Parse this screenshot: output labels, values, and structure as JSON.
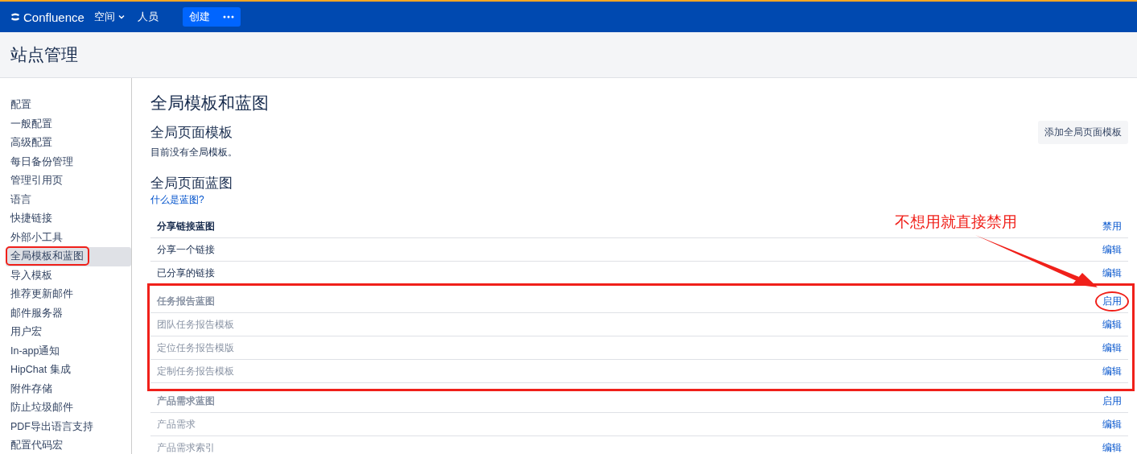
{
  "topbar": {
    "product": "Confluence",
    "nav": [
      {
        "label": "空间",
        "dropdown": true
      },
      {
        "label": "人员",
        "dropdown": false
      }
    ],
    "create": "创建"
  },
  "header": {
    "title": "站点管理"
  },
  "sidebar": {
    "items": [
      {
        "label": "配置",
        "selected": false,
        "highlighted": false
      },
      {
        "label": "一般配置",
        "selected": false,
        "highlighted": false
      },
      {
        "label": "高级配置",
        "selected": false,
        "highlighted": false
      },
      {
        "label": "每日备份管理",
        "selected": false,
        "highlighted": false
      },
      {
        "label": "管理引用页",
        "selected": false,
        "highlighted": false
      },
      {
        "label": "语言",
        "selected": false,
        "highlighted": false
      },
      {
        "label": "快捷链接",
        "selected": false,
        "highlighted": false
      },
      {
        "label": "外部小工具",
        "selected": false,
        "highlighted": false
      },
      {
        "label": "全局模板和蓝图",
        "selected": true,
        "highlighted": true
      },
      {
        "label": "导入模板",
        "selected": false,
        "highlighted": false
      },
      {
        "label": "推荐更新邮件",
        "selected": false,
        "highlighted": false
      },
      {
        "label": "邮件服务器",
        "selected": false,
        "highlighted": false
      },
      {
        "label": "用户宏",
        "selected": false,
        "highlighted": false
      },
      {
        "label": "In-app通知",
        "selected": false,
        "highlighted": false
      },
      {
        "label": "HipChat 集成",
        "selected": false,
        "highlighted": false
      },
      {
        "label": "附件存储",
        "selected": false,
        "highlighted": false
      },
      {
        "label": "防止垃圾邮件",
        "selected": false,
        "highlighted": false
      },
      {
        "label": "PDF导出语言支持",
        "selected": false,
        "highlighted": false
      },
      {
        "label": "配置代码宏",
        "selected": false,
        "highlighted": false
      }
    ]
  },
  "main": {
    "title": "全局模板和蓝图",
    "templates": {
      "heading": "全局页面模板",
      "empty_text": "目前没有全局模板。",
      "add_button": "添加全局页面模板"
    },
    "blueprints": {
      "heading": "全局页面蓝图",
      "help_link": "什么是蓝图?",
      "groups": [
        {
          "name": "分享链接蓝图",
          "enabled": true,
          "action": "禁用",
          "highlighted": false,
          "items": [
            {
              "name": "分享一个链接",
              "action": "编辑"
            },
            {
              "name": "已分享的链接",
              "action": "编辑"
            }
          ]
        },
        {
          "name": "任务报告蓝图",
          "enabled": false,
          "action": "启用",
          "highlighted": true,
          "items": [
            {
              "name": "团队任务报告模板",
              "action": "编辑"
            },
            {
              "name": "定位任务报告模版",
              "action": "编辑"
            },
            {
              "name": "定制任务报告模板",
              "action": "编辑"
            }
          ]
        },
        {
          "name": "产品需求蓝图",
          "enabled": false,
          "action": "启用",
          "highlighted": false,
          "items": [
            {
              "name": "产品需求",
              "action": "编辑"
            },
            {
              "name": "产品需求索引",
              "action": "编辑"
            }
          ]
        }
      ]
    }
  },
  "annotation": {
    "note": "不想用就直接禁用"
  }
}
